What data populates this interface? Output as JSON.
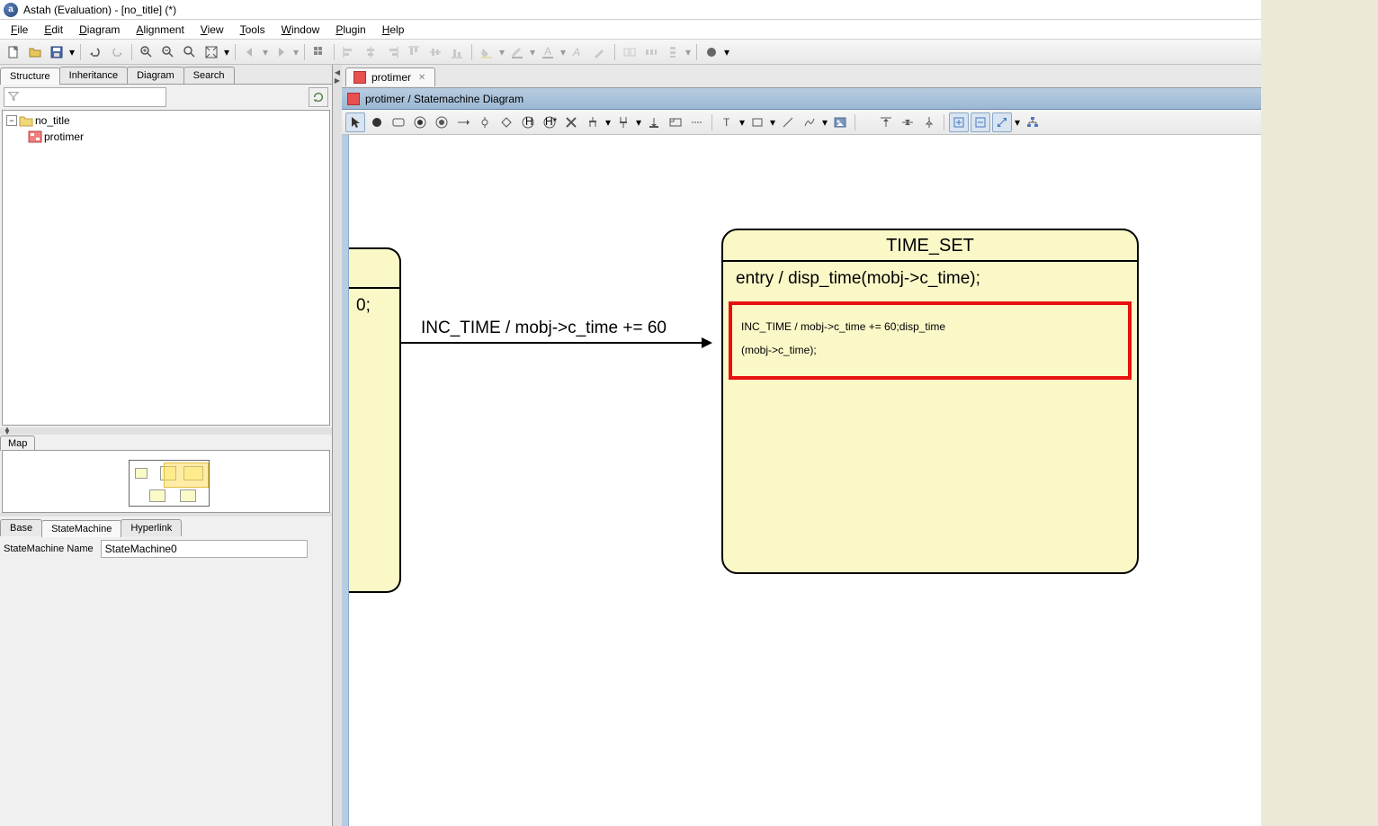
{
  "window": {
    "title": "Astah (Evaluation) - [no_title] (*)"
  },
  "menus": [
    "File",
    "Edit",
    "Diagram",
    "Alignment",
    "View",
    "Tools",
    "Window",
    "Plugin",
    "Help"
  ],
  "left_tabs": [
    "Structure",
    "Inheritance",
    "Diagram",
    "Search"
  ],
  "tree": {
    "root": "no_title",
    "child": "protimer",
    "expand_symbol": "−"
  },
  "map_tab": "Map",
  "props": {
    "tabs": [
      "Base",
      "StateMachine",
      "Hyperlink"
    ],
    "label": "StateMachine Name",
    "value": "StateMachine0"
  },
  "doc_tab": "protimer",
  "diagram_header": "protimer / Statemachine Diagram",
  "canvas": {
    "left_state_text": "0;",
    "transition_label": "INC_TIME / mobj->c_time += 60",
    "state_name": "TIME_SET",
    "entry_text": "entry / disp_time(mobj->c_time);",
    "action_line1": "INC_TIME / mobj->c_time += 60;disp_time",
    "action_line2": "(mobj->c_time);"
  }
}
